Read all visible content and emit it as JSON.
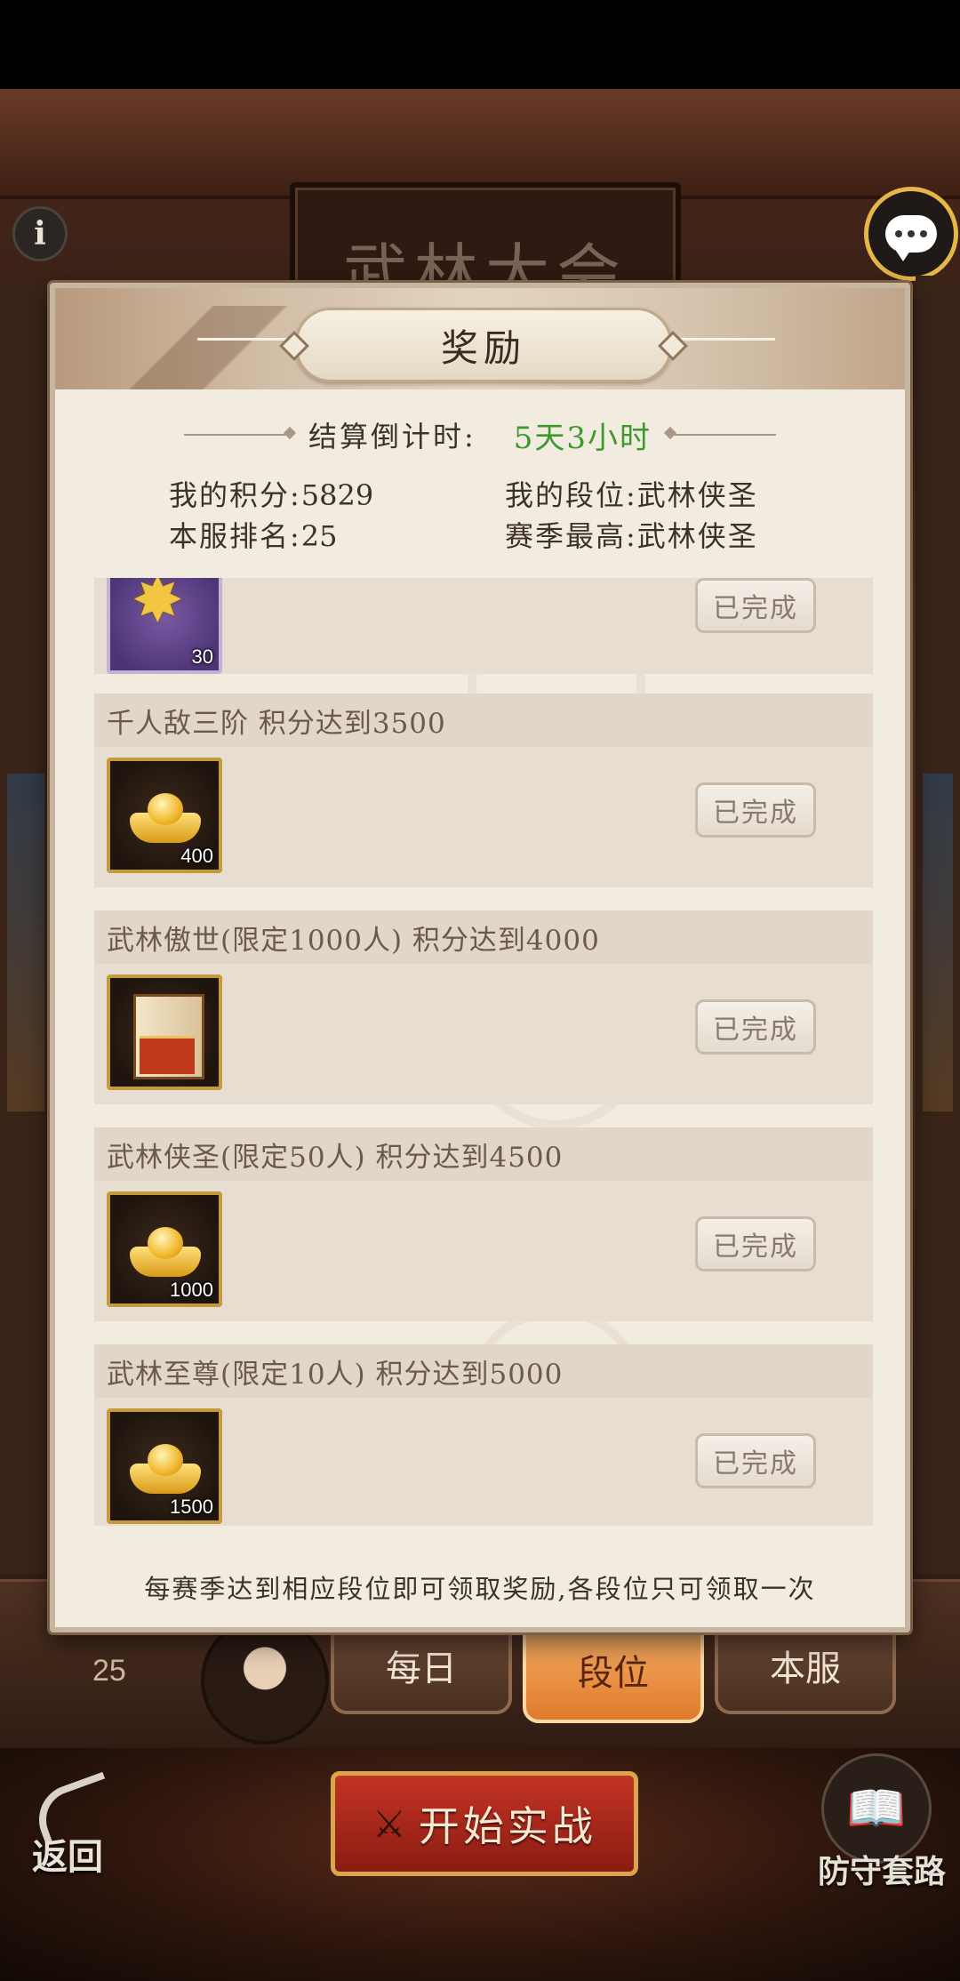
{
  "background": {
    "title": "武林大会",
    "rank_number": "25",
    "tabs": [
      {
        "label": "每日",
        "active": false
      },
      {
        "label": "段位",
        "active": true
      },
      {
        "label": "本服",
        "active": false
      }
    ],
    "back_label": "返回",
    "start_label": "开始实战",
    "defense_label": "防守套路"
  },
  "modal": {
    "title": "奖励",
    "countdown_label": "结算倒计时:",
    "countdown_value": "5天3小时",
    "stats": {
      "my_score_label": "我的积分:",
      "my_score_value": "5829",
      "my_rank_label": "我的段位:",
      "my_rank_value": "武林侠圣",
      "server_rank_label": "本服排名:",
      "server_rank_value": "25",
      "season_best_label": "赛季最高:",
      "season_best_value": "武林侠圣"
    },
    "rewards": [
      {
        "condition": "",
        "item": "star-item",
        "count": "30",
        "status": "已完成"
      },
      {
        "condition": "千人敌三阶 积分达到3500",
        "item": "gold-ingot",
        "count": "400",
        "status": "已完成"
      },
      {
        "condition": "武林傲世(限定1000人) 积分达到4000",
        "item": "book-item",
        "count": "",
        "status": "已完成"
      },
      {
        "condition": "武林侠圣(限定50人) 积分达到4500",
        "item": "gold-ingot",
        "count": "1000",
        "status": "已完成"
      },
      {
        "condition": "武林至尊(限定10人) 积分达到5000",
        "item": "gold-ingot",
        "count": "1500",
        "status": "已完成"
      }
    ],
    "footer": "每赛季达到相应段位即可领取奖励,各段位只可领取一次"
  },
  "colors": {
    "countdown_green": "#3c9a2c",
    "active_tab": "#e07a2c",
    "frame_gold": "#c59a3c"
  },
  "icons": [
    "info-icon",
    "chat-icon",
    "back-arrow-icon",
    "crossed-swords-icon",
    "book-icon"
  ]
}
